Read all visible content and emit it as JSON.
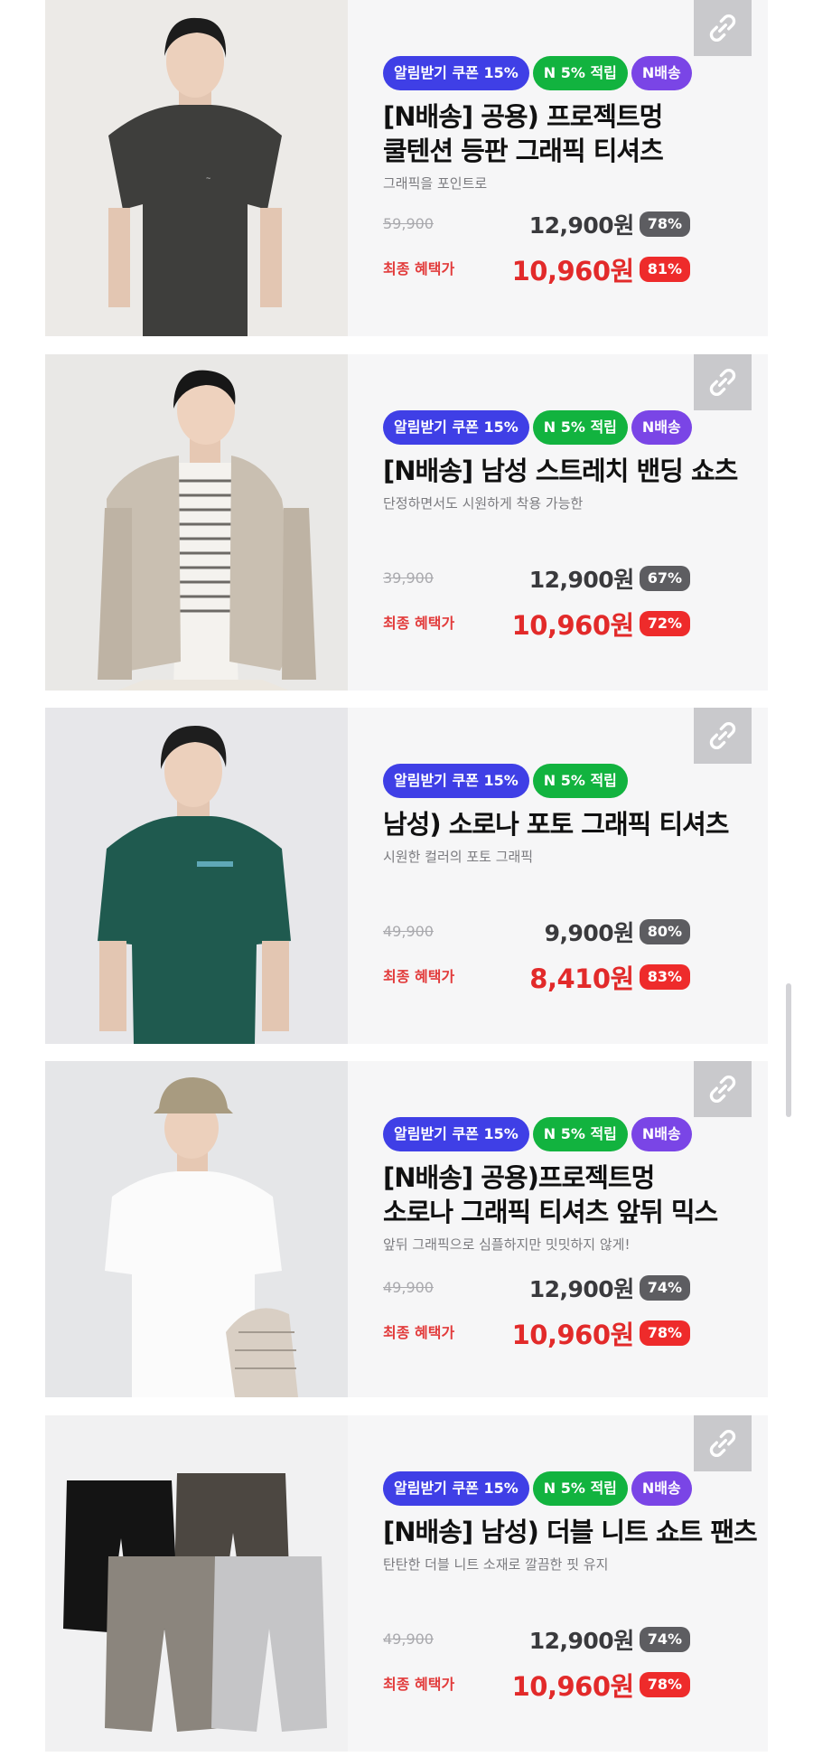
{
  "badges": {
    "coupon": "알림받기 쿠폰 15%",
    "points": "N 5% 적립",
    "delivery": "N배송"
  },
  "final_label": "최종 혜택가",
  "link_icon": "link-icon",
  "products": [
    {
      "title": "[N배송] 공용) 프로젝트멍\n쿨텐션 등판 그래픽 티셔츠",
      "subtitle": "그래픽을 포인트로",
      "original_price": "59,900",
      "price": "12,900원",
      "discount": "78%",
      "final_price": "10,960원",
      "final_discount": "81%"
    },
    {
      "title": "[N배송] 남성 스트레치 밴딩 쇼츠",
      "subtitle": "단정하면서도 시원하게 착용 가능한",
      "original_price": "39,900",
      "price": "12,900원",
      "discount": "67%",
      "final_price": "10,960원",
      "final_discount": "72%"
    },
    {
      "title": "남성) 소로나 포토 그래픽 티셔츠",
      "subtitle": "시원한 컬러의 포토 그래픽",
      "original_price": "49,900",
      "price": "9,900원",
      "discount": "80%",
      "final_price": "8,410원",
      "final_discount": "83%"
    },
    {
      "title": "[N배송] 공용)프로젝트멍\n소로나 그래픽 티셔츠 앞뒤 믹스",
      "subtitle": "앞뒤 그래픽으로 심플하지만 밋밋하지 않게!",
      "original_price": "49,900",
      "price": "12,900원",
      "discount": "74%",
      "final_price": "10,960원",
      "final_discount": "78%"
    },
    {
      "title": "[N배송] 남성) 더블 니트 쇼트 팬츠",
      "subtitle": "탄탄한 더블 니트 소재로 깔끔한 핏 유지",
      "original_price": "49,900",
      "price": "12,900원",
      "discount": "74%",
      "final_price": "10,960원",
      "final_discount": "78%"
    }
  ],
  "colors": {
    "coupon_badge": "#3f3fe6",
    "points_badge": "#12b33f",
    "delivery_badge": "#7a45e6",
    "final_price": "#e22a2a",
    "discount_gray": "#5d5d61",
    "discount_red": "#ee2b2b"
  }
}
